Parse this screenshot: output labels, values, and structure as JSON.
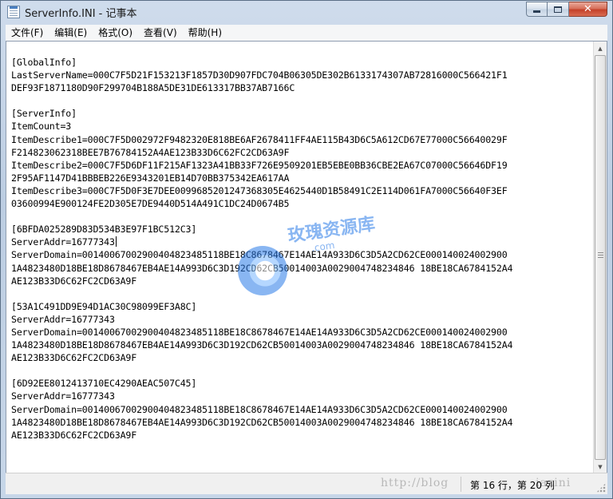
{
  "window": {
    "title": "ServerInfo.INI - 记事本",
    "minimize_label": "",
    "maximize_label": "",
    "close_label": "✕"
  },
  "menu": [
    "文件(F)",
    "编辑(E)",
    "格式(O)",
    "查看(V)",
    "帮助(H)"
  ],
  "editor": {
    "lines": [
      "[GlobalInfo]",
      "LastServerName=000C7F5D21F153213F1857D30D907FDC704B06305DE302B6133174307AB72816000C566421F1",
      "DEF93F1871180D90F299704B188A5DE31DE613317BB37AB7166C",
      "",
      "[ServerInfo]",
      "ItemCount=3",
      "ItemDescribe1=000C7F5D002972F9482320E818BE6AF2678411FF4AE115B43D6C5A612CD67E77000C56640029F",
      "F214823062318BEE7B76784152A4AE123B33D6C62FC2CD63A9F",
      "ItemDescribe2=000C7F5D6DF11F215AF1323A41BB33F726E9509201EB5EBE0BB36CBE2EA67C07000C56646DF19",
      "2F95AF1147D41BBBEB226E9343201EB14D70BB375342EA617AA",
      "ItemDescribe3=000C7F5D0F3E7DEE0099685201247368305E4625440D1B58491C2E114D061FA7000C56640F3EF",
      "03600994E900124FE2D305E7DE9440D514A491C1DC24D0674B5",
      "",
      "[6BFDA025289D83D534B3E97F1BC512C3]",
      "ServerAddr=16777343",
      "ServerDomain=00140067002900404823485118BE18C8678467E14AE14A933D6C3D5A2CD62CE000140024002900",
      "1A4823480D18BE18D8678467EB4AE14A993D6C3D192CD62CB50014003A0029004748234846 18BE18CA6784152A4",
      "AE123B33D6C62FC2CD63A9F",
      "",
      "[53A1C491DD9E94D1AC30C98099EF3A8C]",
      "ServerAddr=16777343",
      "ServerDomain=00140067002900404823485118BE18C8678467E14AE14A933D6C3D5A2CD62CE000140024002900",
      "1A4823480D18BE18D8678467EB4AE14A993D6C3D192CD62CB50014003A0029004748234846 18BE18CA6784152A4",
      "AE123B33D6C62FC2CD63A9F",
      "",
      "[6D92EE8012413710EC4290AEAC507C45]",
      "ServerAddr=16777343",
      "ServerDomain=00140067002900404823485118BE18C8678467E14AE14A933D6C3D5A2CD62CE000140024002900",
      "1A4823480D18BE18D8678467EB4AE14A993D6C3D192CD62CB50014003A0029004748234846 18BE18CA6784152A4",
      "AE123B33D6C62FC2CD63A9F"
    ],
    "caret_line": 14
  },
  "watermark": {
    "text": "玫瑰资源库",
    "sub": ".com",
    "url_visible": "http://blog",
    "url_tail": "iazini"
  },
  "statusbar": {
    "position": "第 16 行，第 20 列"
  },
  "icons": {
    "app": "notepad-icon",
    "scroll_up": "chevron-up-icon",
    "scroll_down": "chevron-down-icon",
    "resize": "resize-grip-icon"
  }
}
